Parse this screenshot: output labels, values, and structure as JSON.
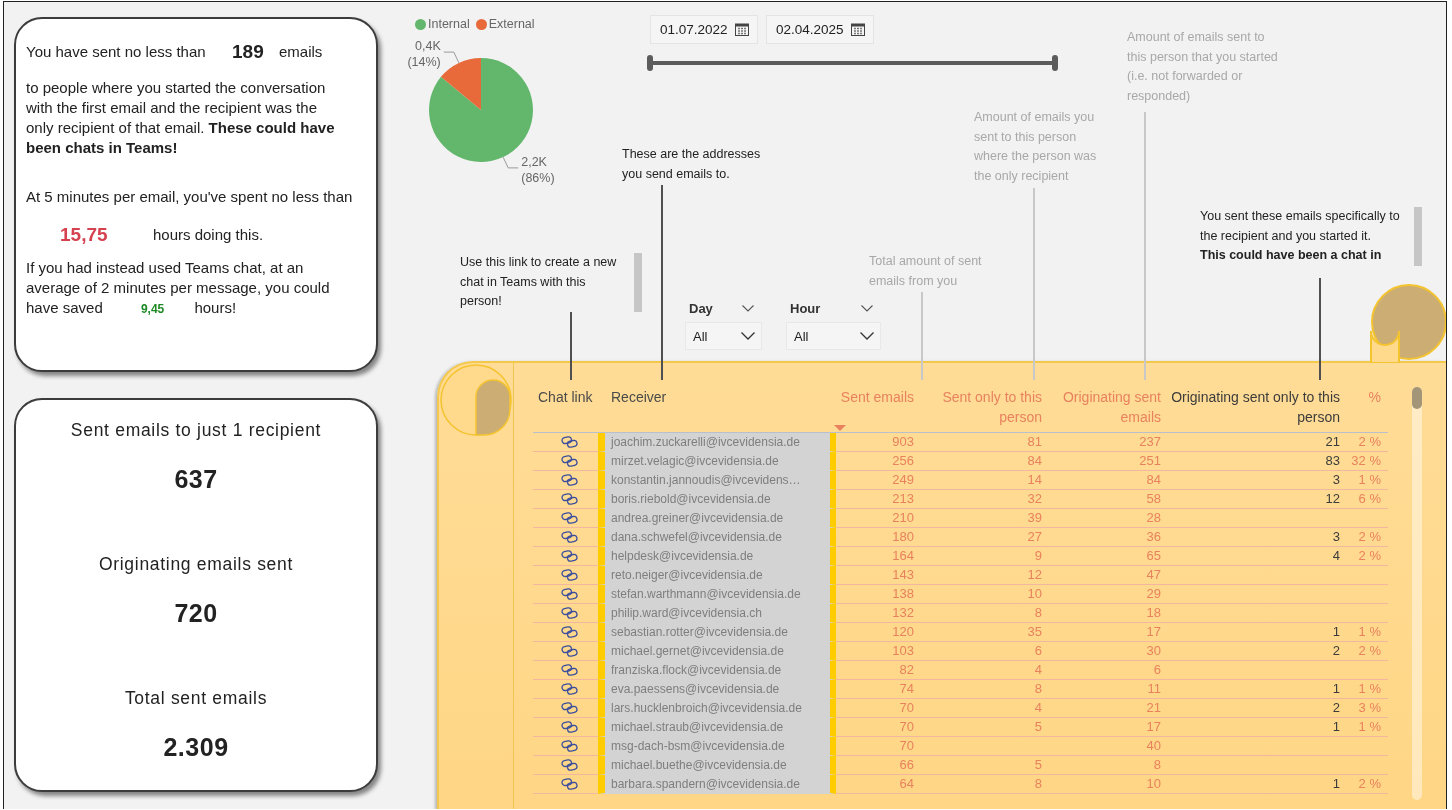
{
  "summary_card": {
    "intro_text": "You have sent no less than",
    "chat_candidates": "189",
    "intro_unit": "emails",
    "explanation": "to people where you started the conversation with the first email and the recipient was the only recipient of that email. **These could have been chats in Teams!**",
    "time_text": "At 5 minutes per email, you've spent no less than",
    "hours_spent": "15,75",
    "hours_text": "hours doing this.",
    "savings_text": "If you had instead used Teams chat, at an average of 2 minutes per message, you could have saved **9,45** hours!"
  },
  "kpi_card": {
    "metrics": [
      {
        "label": "Sent emails to just 1 recipient",
        "value": "637"
      },
      {
        "label": "Originating emails sent",
        "value": "720"
      },
      {
        "label": "Total sent emails",
        "value": "2.309"
      }
    ]
  },
  "pie": {
    "legend": [
      {
        "color": "#63b76c"
      },
      {
        "color": "#e8693a"
      }
    ],
    "chart_data": {
      "type": "pie",
      "categories": [
        "Internal",
        "External"
      ],
      "values": [
        86,
        14
      ],
      "value_labels": [
        "2,2K (86%)",
        "0,4K (14%)"
      ]
    }
  },
  "date_range": {
    "start": "01.07.2022",
    "end": "02.04.2025",
    "level": 1
  },
  "filters": [
    {
      "label": "Day",
      "value": "All"
    },
    {
      "label": "Hour",
      "value": "All"
    }
  ],
  "annotations": [
    {
      "kind": "note",
      "text": "Use this link to create a new chat in Teams with this person!",
      "scrollable": true
    },
    {
      "kind": "note",
      "text": "These are the addresses you send emails to.",
      "scrollable": false
    },
    {
      "kind": "hint",
      "text": "Total amount of sent emails from you",
      "scrollable": false
    },
    {
      "kind": "hint",
      "text": "Amount of emails you sent to this person where the person was the only recipient",
      "scrollable": false
    },
    {
      "kind": "hint",
      "text": "Amount of emails sent to this person that you started (i.e. not forwarded or responded)",
      "scrollable": false
    },
    {
      "kind": "note",
      "text": "You sent these emails specifically to the recipient and you started it.\n**This could have been a chat in**",
      "scrollable": true
    }
  ],
  "table": {
    "columns": [
      {
        "label": "Chat link",
        "kind": "link",
        "color": "#4a4a4a",
        "sorted": false
      },
      {
        "label": "Receiver",
        "kind": "masked",
        "color": "#4a4a4a",
        "sorted": false
      },
      {
        "label": "Sent emails",
        "kind": "number",
        "color": "#e8825e",
        "sorted": true
      },
      {
        "label": "Sent only to this person",
        "kind": "number",
        "color": "#e8825e",
        "sorted": false
      },
      {
        "label": "Originating sent emails",
        "kind": "number",
        "color": "#e8825e",
        "sorted": false
      },
      {
        "label": "Originating sent only to this person",
        "kind": "number",
        "color": "#3c3c3c",
        "sorted": false
      },
      {
        "label": "%",
        "kind": "number",
        "color": "#e8825e",
        "sorted": false
      }
    ],
    "rows": [
      {
        "receiver": "joachim.zuckarelli@ivcevidensia.de",
        "sent": "903",
        "sent_only": "81",
        "originating": "237",
        "originating_only": "21",
        "share": "2 %"
      },
      {
        "receiver": "mirzet.velagic@ivcevidensia.de",
        "sent": "256",
        "sent_only": "84",
        "originating": "251",
        "originating_only": "83",
        "share": "32 %"
      },
      {
        "receiver": "konstantin.jannoudis@ivcevidens…",
        "sent": "249",
        "sent_only": "14",
        "originating": "84",
        "originating_only": "3",
        "share": "1 %"
      },
      {
        "receiver": "boris.riebold@ivcevidensia.de",
        "sent": "213",
        "sent_only": "32",
        "originating": "58",
        "originating_only": "12",
        "share": "6 %"
      },
      {
        "receiver": "andrea.greiner@ivcevidensia.de",
        "sent": "210",
        "sent_only": "39",
        "originating": "28"
      },
      {
        "receiver": "dana.schwefel@ivcevidensia.de",
        "sent": "180",
        "sent_only": "27",
        "originating": "36",
        "originating_only": "3",
        "share": "2 %"
      },
      {
        "receiver": "helpdesk@ivcevidensia.de",
        "sent": "164",
        "sent_only": "9",
        "originating": "65",
        "originating_only": "4",
        "share": "2 %"
      },
      {
        "receiver": "reto.neiger@ivcevidensia.de",
        "sent": "143",
        "sent_only": "12",
        "originating": "47"
      },
      {
        "receiver": "stefan.warthmann@ivcevidensia.de",
        "sent": "138",
        "sent_only": "10",
        "originating": "29"
      },
      {
        "receiver": "philip.ward@ivcevidensia.ch",
        "sent": "132",
        "sent_only": "8",
        "originating": "18"
      },
      {
        "receiver": "sebastian.rotter@ivcevidensia.de",
        "sent": "120",
        "sent_only": "35",
        "originating": "17",
        "originating_only": "1",
        "share": "1 %"
      },
      {
        "receiver": "michael.gernet@ivcevidensia.de",
        "sent": "103",
        "sent_only": "6",
        "originating": "30",
        "originating_only": "2",
        "share": "2 %"
      },
      {
        "receiver": "franziska.flock@ivcevidensia.de",
        "sent": "82",
        "sent_only": "4",
        "originating": "6"
      },
      {
        "receiver": "eva.paessens@ivcevidensia.de",
        "sent": "74",
        "sent_only": "8",
        "originating": "11",
        "originating_only": "1",
        "share": "1 %"
      },
      {
        "receiver": "lars.hucklenbroich@ivcevidensia.de",
        "sent": "70",
        "sent_only": "4",
        "originating": "21",
        "originating_only": "2",
        "share": "3 %"
      },
      {
        "receiver": "michael.straub@ivcevidensia.de",
        "sent": "70",
        "sent_only": "5",
        "originating": "17",
        "originating_only": "1",
        "share": "1 %"
      },
      {
        "receiver": "msg-dach-bsm@ivcevidensia.de",
        "sent": "70",
        "originating": "40"
      },
      {
        "receiver": "michael.buethe@ivcevidensia.de",
        "sent": "66",
        "sent_only": "5",
        "originating": "8"
      },
      {
        "receiver": "barbara.spandern@ivcevidensia.de",
        "sent": "64",
        "sent_only": "8",
        "originating": "10",
        "originating_only": "1",
        "share": "2 %"
      }
    ]
  }
}
